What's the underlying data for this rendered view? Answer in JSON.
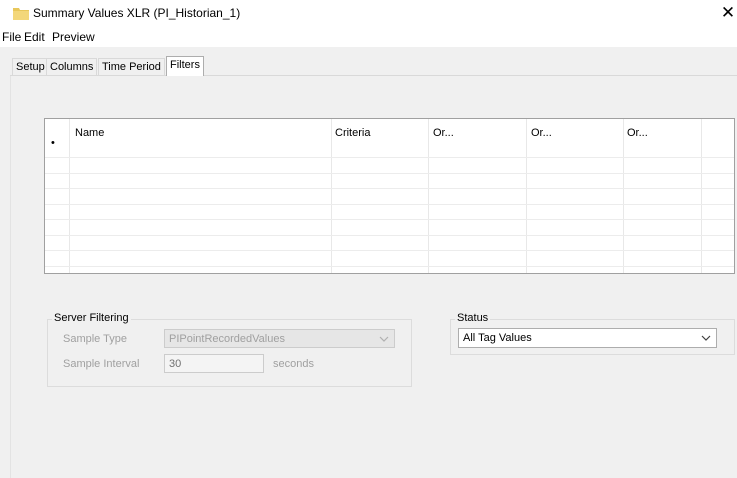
{
  "window": {
    "title": "Summary Values XLR (PI_Historian_1)",
    "close_glyph": "✕",
    "icon": "folder-icon"
  },
  "menu": [
    "File",
    "Edit",
    "Preview"
  ],
  "tabs": [
    {
      "label": "Setup",
      "active": false
    },
    {
      "label": "Columns",
      "active": false
    },
    {
      "label": "Time Period",
      "active": false
    },
    {
      "label": "Filters",
      "active": true
    }
  ],
  "filters_grid": {
    "columns": [
      "Name",
      "Criteria",
      "Or...",
      "Or...",
      "Or..."
    ],
    "new_row_marker": "•",
    "rows": []
  },
  "server_filtering": {
    "title": "Server Filtering",
    "sample_type_label": "Sample Type",
    "sample_type_value": "PIPointRecordedValues",
    "sample_interval_label": "Sample Interval",
    "sample_interval_value": "30",
    "sample_interval_unit": "seconds"
  },
  "status": {
    "title": "Status",
    "value": "All Tag Values"
  },
  "colors": {
    "background": "#f0f0f0",
    "folder": "#e8c75a",
    "disabled_text": "#a0a0a0"
  }
}
